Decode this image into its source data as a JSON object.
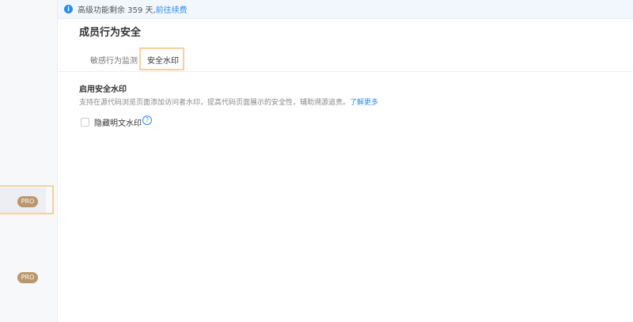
{
  "notice": {
    "text": "高级功能剩余 359 天,",
    "link": "前往续费"
  },
  "page": {
    "title": "成员行为安全"
  },
  "tabs": [
    {
      "label": "敏感行为监测"
    },
    {
      "label": "安全水印"
    }
  ],
  "section": {
    "title": "启用安全水印",
    "description": "支持在源代码浏览页面添加访问者水印，提高代码页面展示的安全性，辅助溯源追责。",
    "learn_more": "了解更多"
  },
  "options": {
    "hide_plain_watermark": "隐藏明文水印",
    "help_glyph": "?"
  },
  "sidebar": {
    "badges": [
      "PRO",
      "PRO"
    ]
  },
  "colors": {
    "accent": "#2d8cf0",
    "pro_badge": "#b9966b",
    "highlight": "#f7cfa0"
  }
}
